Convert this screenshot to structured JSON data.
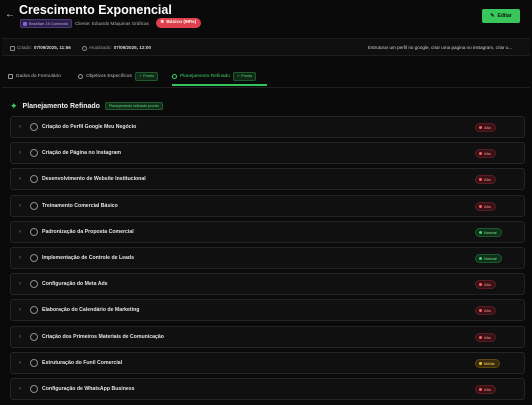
{
  "header": {
    "title": "Crescimento Exponencial",
    "project_tag": "Brazilian 15 Conteúdo",
    "client_label": "Cliente: Eduardo Máquinas Gráficas",
    "plan_badge": "Básico (99%)",
    "edit_label": "Editar"
  },
  "meta": {
    "created_label": "Criado:",
    "created_value": "07/09/2025, 11:56",
    "updated_label": "Atualizado:",
    "updated_value": "07/09/2025, 12:00",
    "description": "Estruturar um perfil no google, criar uma pagina no instagram, criar u..."
  },
  "tabs": [
    {
      "label": "Dados do Formulário",
      "badge": ""
    },
    {
      "label": "Objetivos Específicos",
      "badge": "Pronto"
    },
    {
      "label": "Planejamento Refinado",
      "badge": "Pronto"
    }
  ],
  "section": {
    "title": "Planejamento Refinado",
    "badge": "Planejamento refinado pronto"
  },
  "items": [
    {
      "title": "Criação do Perfil Google Meu Negócio",
      "priority": "Alta"
    },
    {
      "title": "Criação de Página no Instagram",
      "priority": "Alta"
    },
    {
      "title": "Desenvolvimento de Website Institucional",
      "priority": "Alta"
    },
    {
      "title": "Treinamento Comercial Básico",
      "priority": "Alta"
    },
    {
      "title": "Padronização da Proposta Comercial",
      "priority": "Normal"
    },
    {
      "title": "Implementação de Controle de Leads",
      "priority": "Normal"
    },
    {
      "title": "Configuração do Meta Ads",
      "priority": "Alta"
    },
    {
      "title": "Elaboração do Calendário de Marketing",
      "priority": "Alta"
    },
    {
      "title": "Criação dos Primeiros Materiais de Comunicação",
      "priority": "Alta"
    },
    {
      "title": "Estruturação do Funil Comercial",
      "priority": "Média"
    },
    {
      "title": "Configuração de WhatsApp Business",
      "priority": "Alta"
    }
  ],
  "colors": {
    "accent": "#3fd06a",
    "alta": "#ff5b66",
    "normal": "#44d46e",
    "media": "#f5c02e"
  }
}
